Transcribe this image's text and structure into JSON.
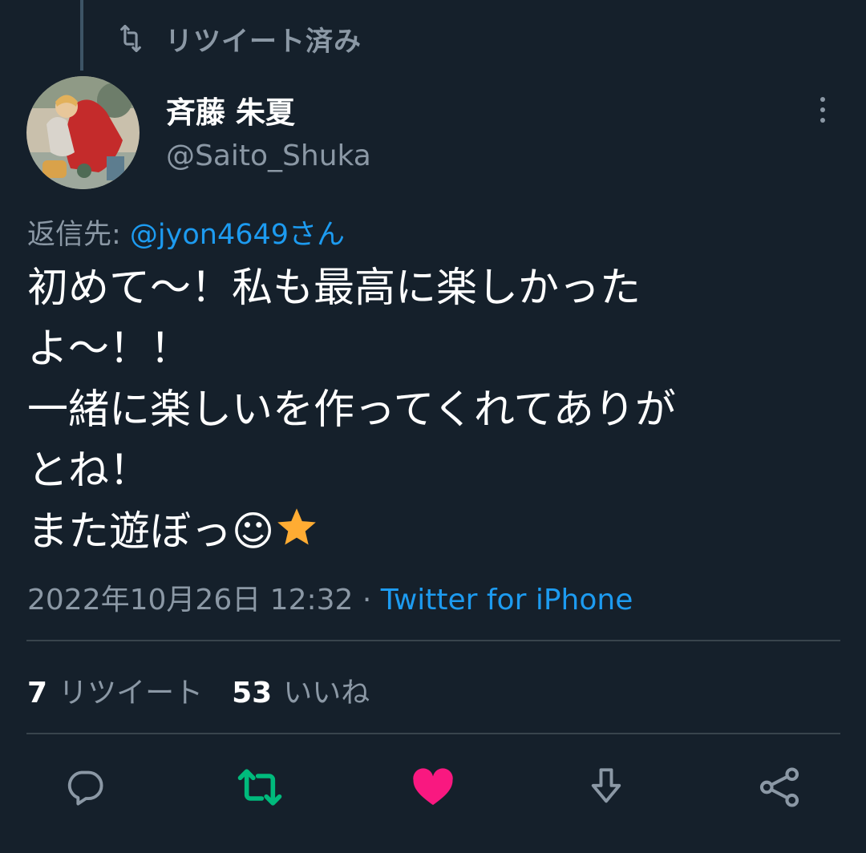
{
  "retweeted": {
    "label": "リツイート済み",
    "icon": "retweet-icon"
  },
  "author": {
    "display_name": "斉藤 朱夏",
    "handle": "@Saito_Shuka"
  },
  "reply_to": {
    "prefix": "返信先: ",
    "mention": "@jyon4649さん"
  },
  "tweet": {
    "text": "初めて〜！私も最高に楽しかった\nよ〜！！\n一緒に楽しいを作ってくれてありが\nとね！\nまた遊ぼっ☺",
    "trailing_emoji": "star-emoji"
  },
  "meta": {
    "timestamp": "2022年10月26日 12:32",
    "separator": " · ",
    "source": "Twitter for iPhone"
  },
  "stats": {
    "retweets_count": "7",
    "retweets_label": "リツイート",
    "likes_count": "53",
    "likes_label": "いいね"
  },
  "actions": [
    {
      "name": "reply",
      "icon": "reply-icon"
    },
    {
      "name": "retweet",
      "icon": "retweet-icon",
      "active": true
    },
    {
      "name": "like",
      "icon": "heart-icon",
      "active": true
    },
    {
      "name": "download",
      "icon": "download-icon"
    },
    {
      "name": "share",
      "icon": "share-icon"
    }
  ],
  "colors": {
    "background": "#15202b",
    "text": "#ffffff",
    "muted": "#8b98a5",
    "link": "#1d9bf0",
    "divider": "#38444d",
    "retweet_active": "#00ba7c",
    "like_active": "#f91880",
    "star": "#ffac33"
  }
}
